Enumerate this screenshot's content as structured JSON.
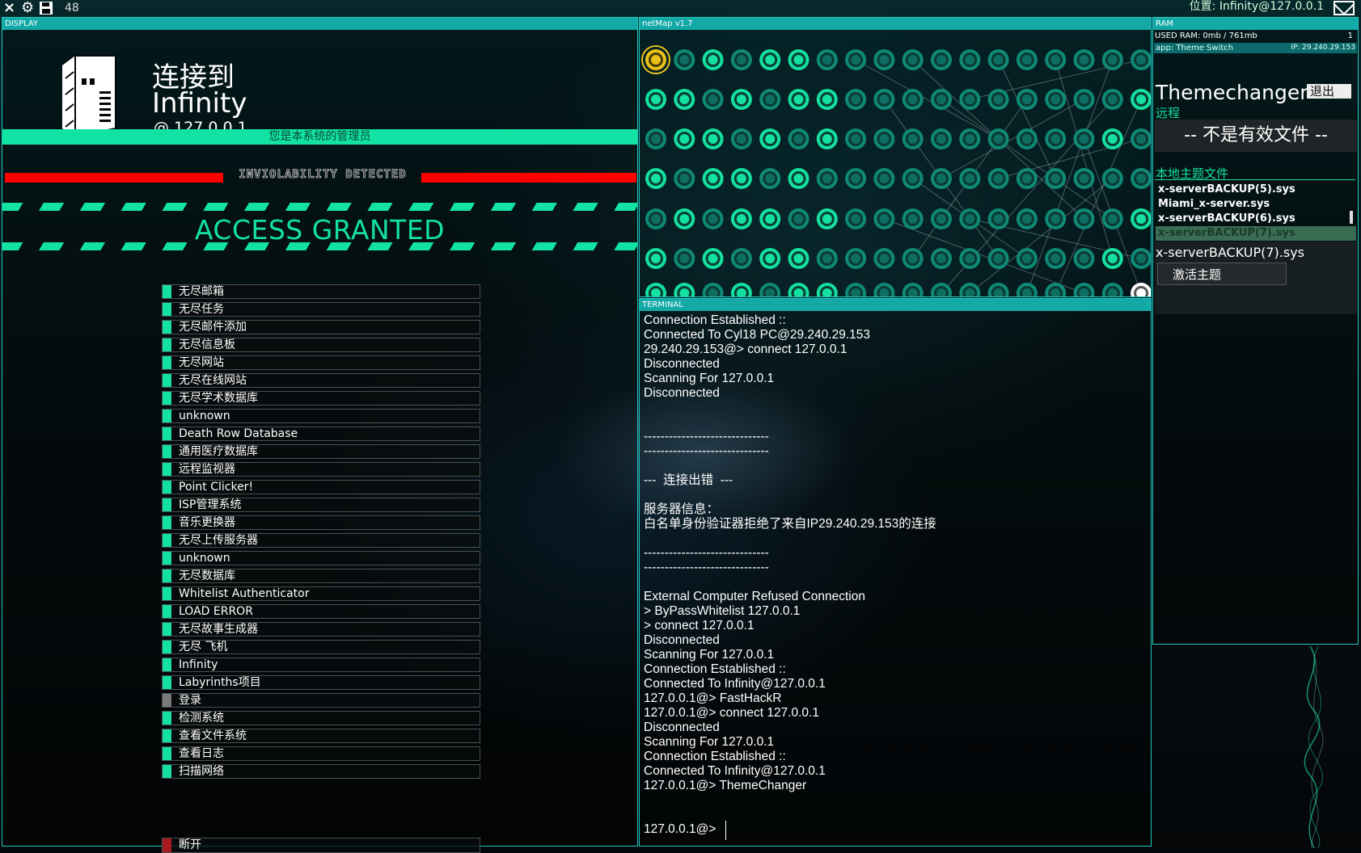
{
  "topbar": {
    "close_icon": "×",
    "settings_icon": "⚙",
    "count": "48",
    "location": "位置: Infinity@127.0.0.1"
  },
  "display": {
    "panel_title": "DISPLAY",
    "connect_label": "连接到",
    "host_name": "Infinity",
    "host_ip": "@   127.0.0.1",
    "admin_notice": "您是本系统的管理员",
    "inviolability": "INVIOLABILITY DETECTED",
    "access_text": "ACCESS GRANTED",
    "menu": [
      {
        "label": "无尽邮箱"
      },
      {
        "label": "无尽任务"
      },
      {
        "label": "无尽邮件添加"
      },
      {
        "label": "无尽信息板"
      },
      {
        "label": "无尽网站"
      },
      {
        "label": "无尽在线网站"
      },
      {
        "label": "无尽学术数据库"
      },
      {
        "label": "unknown"
      },
      {
        "label": "Death Row Database"
      },
      {
        "label": "通用医疗数据库"
      },
      {
        "label": "远程监视器"
      },
      {
        "label": "Point Clicker!"
      },
      {
        "label": "ISP管理系统"
      },
      {
        "label": "音乐更换器"
      },
      {
        "label": "无尽上传服务器"
      },
      {
        "label": "unknown"
      },
      {
        "label": "无尽数据库"
      },
      {
        "label": "Whitelist Authenticator"
      },
      {
        "label": "LOAD ERROR"
      },
      {
        "label": "无尽故事生成器"
      },
      {
        "label": "无尽 飞机"
      },
      {
        "label": "Infinity"
      },
      {
        "label": "Labyrinths项目"
      },
      {
        "label": "登录",
        "style": "grey"
      },
      {
        "label": "检测系统"
      },
      {
        "label": "查看文件系统"
      },
      {
        "label": "查看日志"
      },
      {
        "label": "扫描网络"
      }
    ],
    "disconnect_label": "断开",
    "colors": {
      "accent": "#13e0a1",
      "danger": "#ff0000",
      "disconnect": "#a5191f"
    }
  },
  "netmap": {
    "panel_title": "netMap v1.7",
    "rows": 7,
    "cols": 18,
    "selected_node": "yellow",
    "home_node": "white"
  },
  "terminal": {
    "panel_title": "TERMINAL",
    "lines": [
      "Connection Established ::",
      "Connected To Cyl18 PC@29.240.29.153",
      "29.240.29.153@> connect 127.0.0.1",
      "Disconnected",
      "Scanning For 127.0.0.1",
      "Disconnected",
      "",
      "",
      "------------------------------",
      "------------------------------",
      "",
      "---  连接出错  ---",
      "",
      "服务器信息：",
      "白名单身份验证器拒绝了来自IP29.240.29.153的连接",
      "",
      "------------------------------",
      "------------------------------",
      "",
      "External Computer Refused Connection",
      "> ByPassWhitelist 127.0.0.1",
      "> connect 127.0.0.1",
      "Disconnected",
      "Scanning For 127.0.0.1",
      "Connection Established ::",
      "Connected To Infinity@127.0.0.1",
      "127.0.0.1@> FastHackR",
      "127.0.0.1@> connect 127.0.0.1",
      "Disconnected",
      "Scanning For 127.0.0.1",
      "Connection Established ::",
      "Connected To Infinity@127.0.0.1",
      "127.0.0.1@> ThemeChanger"
    ],
    "prompt": "127.0.0.1@>"
  },
  "ram": {
    "panel_title": "RAM",
    "used": "USED RAM: 0mb / 761mb",
    "count": "1",
    "app_label": "app: Theme Switch",
    "app_ip": "IP: 29.240.29.153"
  },
  "themechanger": {
    "title": "Themechanger",
    "exit_label": "退出",
    "remote_label": "远程",
    "invalid_file": "-- 不是有效文件 --",
    "local_label": "本地主题文件",
    "files": [
      "x-serverBACKUP(5).sys",
      "Miami_x-server.sys",
      "x-serverBACKUP(6).sys",
      "x-serverBACKUP(7).sys"
    ],
    "selected_file": "x-serverBACKUP(7).sys",
    "activate_label": "激活主题"
  }
}
